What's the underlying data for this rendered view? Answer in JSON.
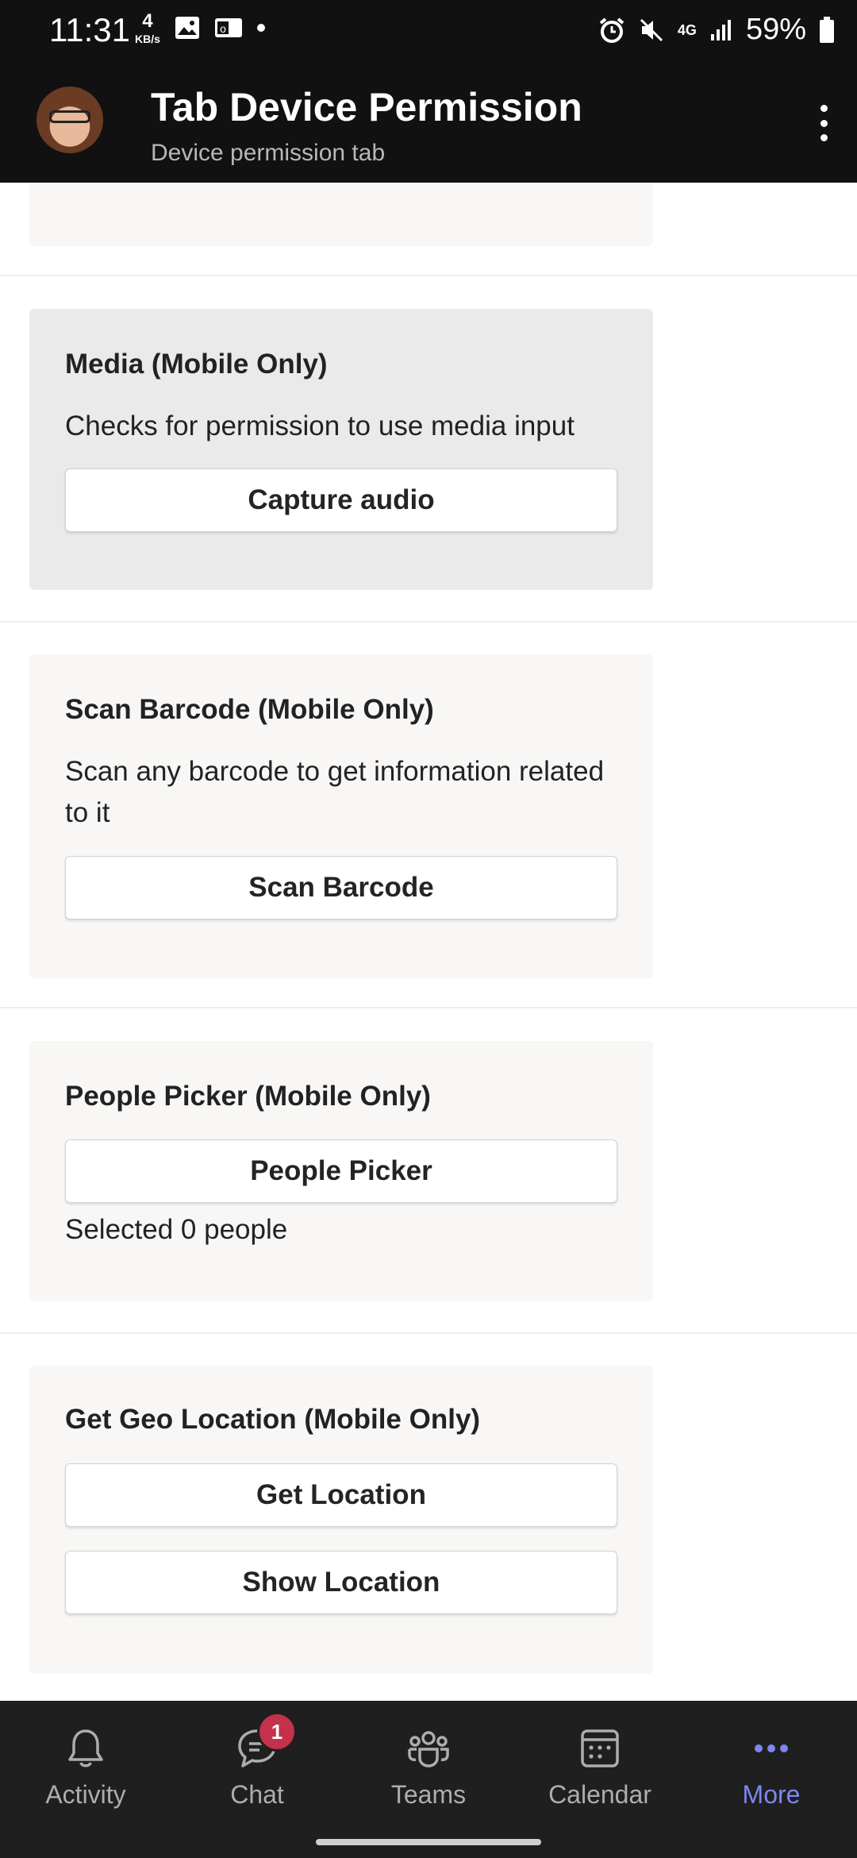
{
  "status_bar": {
    "time": "11:31",
    "net_speed_value": "4",
    "net_speed_unit": "KB/s",
    "network": "4G",
    "battery": "59%"
  },
  "header": {
    "title": "Tab Device Permission",
    "subtitle": "Device permission tab"
  },
  "sections": {
    "media": {
      "title": "Media (Mobile Only)",
      "description": "Checks for permission to use media input",
      "button": "Capture audio"
    },
    "barcode": {
      "title": "Scan Barcode (Mobile Only)",
      "description": "Scan any barcode to get information related to it",
      "button": "Scan Barcode"
    },
    "people": {
      "title": "People Picker (Mobile Only)",
      "button": "People Picker",
      "note": "Selected 0 people"
    },
    "geo": {
      "title": "Get Geo Location (Mobile Only)",
      "button_get": "Get Location",
      "button_show": "Show Location"
    }
  },
  "nav": {
    "items": [
      {
        "label": "Activity",
        "icon": "bell-icon"
      },
      {
        "label": "Chat",
        "icon": "chat-icon",
        "badge": "1"
      },
      {
        "label": "Teams",
        "icon": "teams-icon"
      },
      {
        "label": "Calendar",
        "icon": "calendar-icon"
      },
      {
        "label": "More",
        "icon": "more-icon",
        "selected": true
      }
    ]
  },
  "colors": {
    "accent": "#7f85f5",
    "badge": "#c4314b",
    "header_bg": "#111111",
    "card_bg": "#f8f7f6"
  }
}
